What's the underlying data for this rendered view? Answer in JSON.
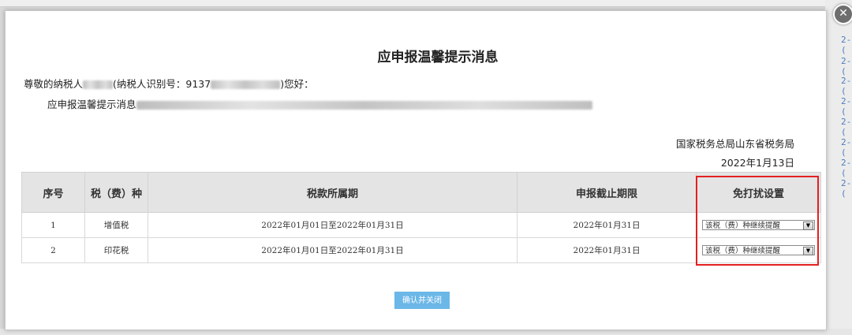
{
  "dialog": {
    "title": "应申报温馨提示消息",
    "greeting_prefix": "尊敬的纳税人",
    "greeting_taxid_label": "(纳税人识别号：9137",
    "greeting_suffix": ")您好：",
    "message": "应申报温馨提示消息",
    "agency": "国家税务总局山东省税务局",
    "date": "2022年1月13日",
    "confirm_label": "确认并关闭",
    "close_glyph": "✕"
  },
  "table": {
    "headers": [
      "序号",
      "税（费）种",
      "税款所属期",
      "申报截止期限",
      "免打扰设置"
    ],
    "rows": [
      {
        "index": "1",
        "tax": "增值税",
        "period": "2022年01月01日至2022年01月31日",
        "deadline": "2022年01月31日",
        "setting": "该税（费）种继续提醒"
      },
      {
        "index": "2",
        "tax": "印花税",
        "period": "2022年01月01日至2022年01月31日",
        "deadline": "2022年01月31日",
        "setting": "该税（费）种继续提醒"
      }
    ]
  },
  "background": {
    "edge_labels": [
      "2-(",
      "2-(",
      "2-(",
      "2-(",
      "2-(",
      "2-(",
      "2-(",
      "2-("
    ]
  },
  "colors": {
    "highlight": "#e32020",
    "confirm_button": "#6bb7e8",
    "header_bg": "#e4e4e4"
  }
}
